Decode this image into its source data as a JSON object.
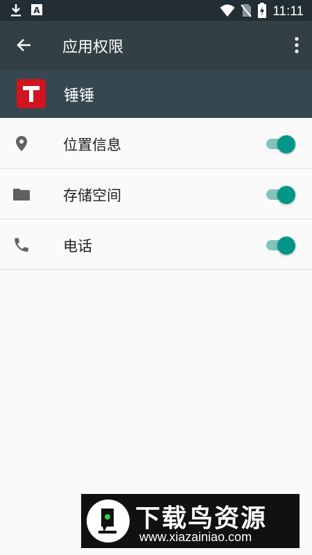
{
  "status_bar": {
    "time": "11:11",
    "icons": [
      "download-icon",
      "a-notification-icon",
      "wifi-icon",
      "no-sim-icon",
      "battery-charging-icon"
    ]
  },
  "app_bar": {
    "title": "应用权限",
    "back_icon": "arrow-left-icon",
    "menu_icon": "more-vert-icon"
  },
  "app_header": {
    "app_icon_letter": "T",
    "app_icon_color": "#d01520",
    "app_name": "锤锤"
  },
  "permissions": [
    {
      "label": "位置信息",
      "icon": "location-icon",
      "enabled": true
    },
    {
      "label": "存储空间",
      "icon": "folder-icon",
      "enabled": true
    },
    {
      "label": "电话",
      "icon": "phone-icon",
      "enabled": true
    }
  ],
  "colors": {
    "status_bar": "#222e33",
    "app_bar": "#323f45",
    "app_header": "#37474f",
    "accent": "#009688",
    "background": "#fafafa"
  },
  "watermark": {
    "title": "下载鸟资源",
    "url": "www.xiazainiao.com"
  }
}
